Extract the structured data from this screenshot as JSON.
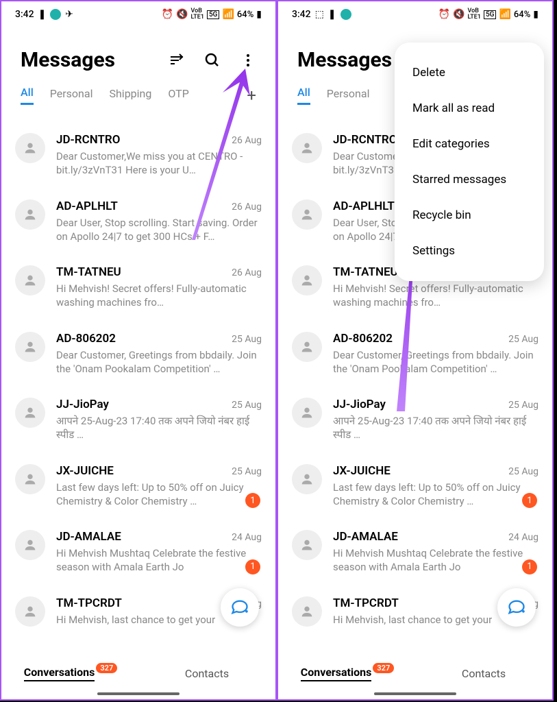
{
  "status": {
    "time": "3:42",
    "battery": "64%",
    "network": "5G"
  },
  "header": {
    "title": "Messages"
  },
  "tabs": {
    "items": [
      "All",
      "Personal",
      "Shipping",
      "OTP"
    ],
    "active": 0
  },
  "messages": [
    {
      "sender": "JD-RCNTRO",
      "date": "26 Aug",
      "preview": "Dear Customer,We miss you at CENTRO - bit.ly/3zVnT31 Here is your U…",
      "badge": null
    },
    {
      "sender": "AD-APLHLT",
      "date": "26 Aug",
      "preview": "Dear User,  Stop scrolling. Start saving. Order on Apollo 24|7 to get 300 HCs + F…",
      "badge": null
    },
    {
      "sender": "TM-TATNEU",
      "date": "26 Aug",
      "preview": "Hi Mehvish! Secret offers! Fully-automatic washing machines fro…",
      "badge": null
    },
    {
      "sender": "AD-806202",
      "date": "25 Aug",
      "preview": "Dear Customer, Greetings from bbdaily. Join the 'Onam Pookalam Competition' …",
      "badge": null
    },
    {
      "sender": "JJ-JioPay",
      "date": "25 Aug",
      "preview": "आपने 25-Aug-23 17:40 तक अपने जियो नंबर                                          हाई स्पीड …",
      "badge": null
    },
    {
      "sender": "JX-JUICHE",
      "date": "25 Aug",
      "preview": "Last few days left: Up to 50% off on Juicy Chemistry & Color Chemistry …",
      "badge": "1"
    },
    {
      "sender": "JD-AMALAE",
      "date": "24 Aug",
      "preview": "Hi Mehvish Mushtaq Celebrate the festive season with Amala Earth Jo",
      "badge": "1"
    },
    {
      "sender": "TM-TPCRDT",
      "date": "24 Aug",
      "preview": "Hi Mehvish, last chance to get your",
      "badge": null
    }
  ],
  "bottomNav": {
    "conversations": "Conversations",
    "contacts": "Contacts",
    "badge": "327"
  },
  "menu": {
    "items": [
      "Delete",
      "Mark all as read",
      "Edit categories",
      "Starred messages",
      "Recycle bin",
      "Settings"
    ]
  }
}
